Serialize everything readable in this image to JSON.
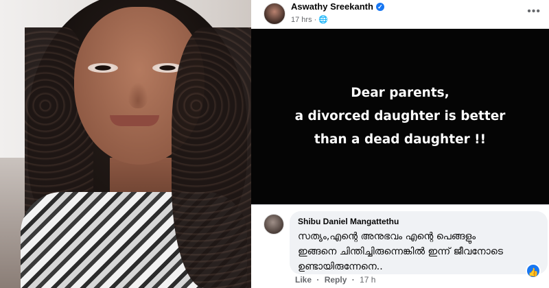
{
  "post": {
    "author": "Aswathy Sreekanth",
    "time": "17 hrs",
    "audience_icon": "globe-icon",
    "more_icon": "more-options-icon",
    "image_text": [
      "Dear parents,",
      "a divorced daughter is better",
      "than a dead daughter !!"
    ],
    "image_bg": "#050505",
    "image_text_color": "#ffffff"
  },
  "comment": {
    "author": "Shibu Daniel Mangattethu",
    "lines": [
      "സത്യം,എന്റെ അനുഭവം എന്റെ പെങ്ങളും",
      "ഇങ്ങനെ ചിന്തിച്ചിരുന്നെങ്കിൽ ഇന്ന് ജീവനോടെ",
      "ഉണ്ടായിരുന്നേനെ.."
    ],
    "like_label": "Like",
    "separator": "·",
    "reply_label": "Reply",
    "time": "17 h",
    "reaction_icon": "like-reaction-icon"
  },
  "colors": {
    "facebook_blue": "#1877f2",
    "bubble": "#f0f2f5",
    "meta_text": "#65676b"
  }
}
